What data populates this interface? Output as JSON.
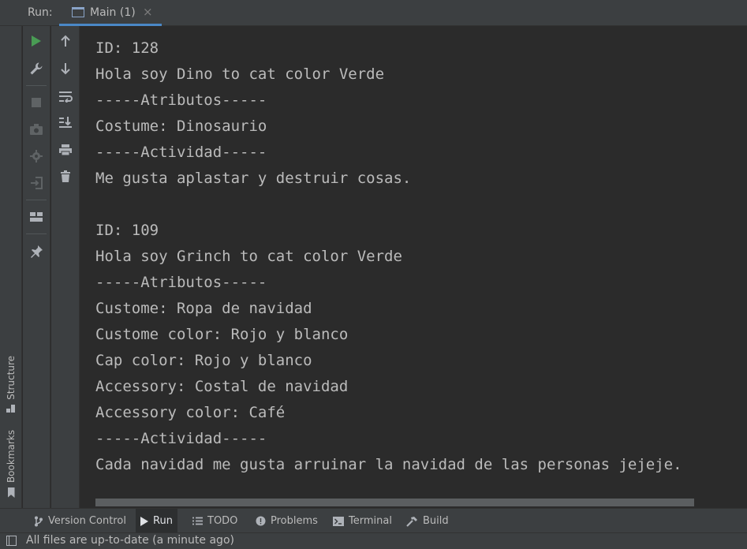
{
  "topbar": {
    "run_label": "Run:",
    "tab_title": "Main (1)",
    "tab_close": "×"
  },
  "left_stripe": {
    "structure_label": "Structure",
    "bookmarks_label": "Bookmarks"
  },
  "toolbar1": {
    "icons": [
      "rerun-icon",
      "edit-config-icon",
      "stop-icon",
      "dump-threads-icon",
      "settings-icon",
      "exit-icon",
      "layout-icon",
      "pin-icon"
    ],
    "colors": {
      "run": "#499c54",
      "icon": "#aeb2b8",
      "disabled": "#5f6365"
    }
  },
  "toolbar2": {
    "icons": [
      "scroll-up-icon",
      "scroll-down-icon",
      "soft-wrap-icon",
      "scroll-to-end-icon",
      "print-icon",
      "clear-all-icon"
    ]
  },
  "console": {
    "lines": [
      "ID: 128",
      "Hola soy Dino to cat color Verde",
      "-----Atributos-----",
      "Costume: Dinosaurio",
      "-----Actividad-----",
      "Me gusta aplastar y destruir cosas.",
      "",
      "ID: 109",
      "Hola soy Grinch to cat color Verde",
      "-----Atributos-----",
      "Custome: Ropa de navidad",
      "Custome color: Rojo y blanco",
      "Cap color: Rojo y blanco",
      "Accessory: Costal de navidad",
      "Accessory color: Café",
      "-----Actividad-----",
      "Cada navidad me gusta arruinar la navidad de las personas jejeje."
    ]
  },
  "bottombar": {
    "version_control": "Version Control",
    "run": "Run",
    "todo": "TODO",
    "problems": "Problems",
    "terminal": "Terminal",
    "build": "Build"
  },
  "status": {
    "text": "All files are up-to-date (a minute ago)"
  }
}
